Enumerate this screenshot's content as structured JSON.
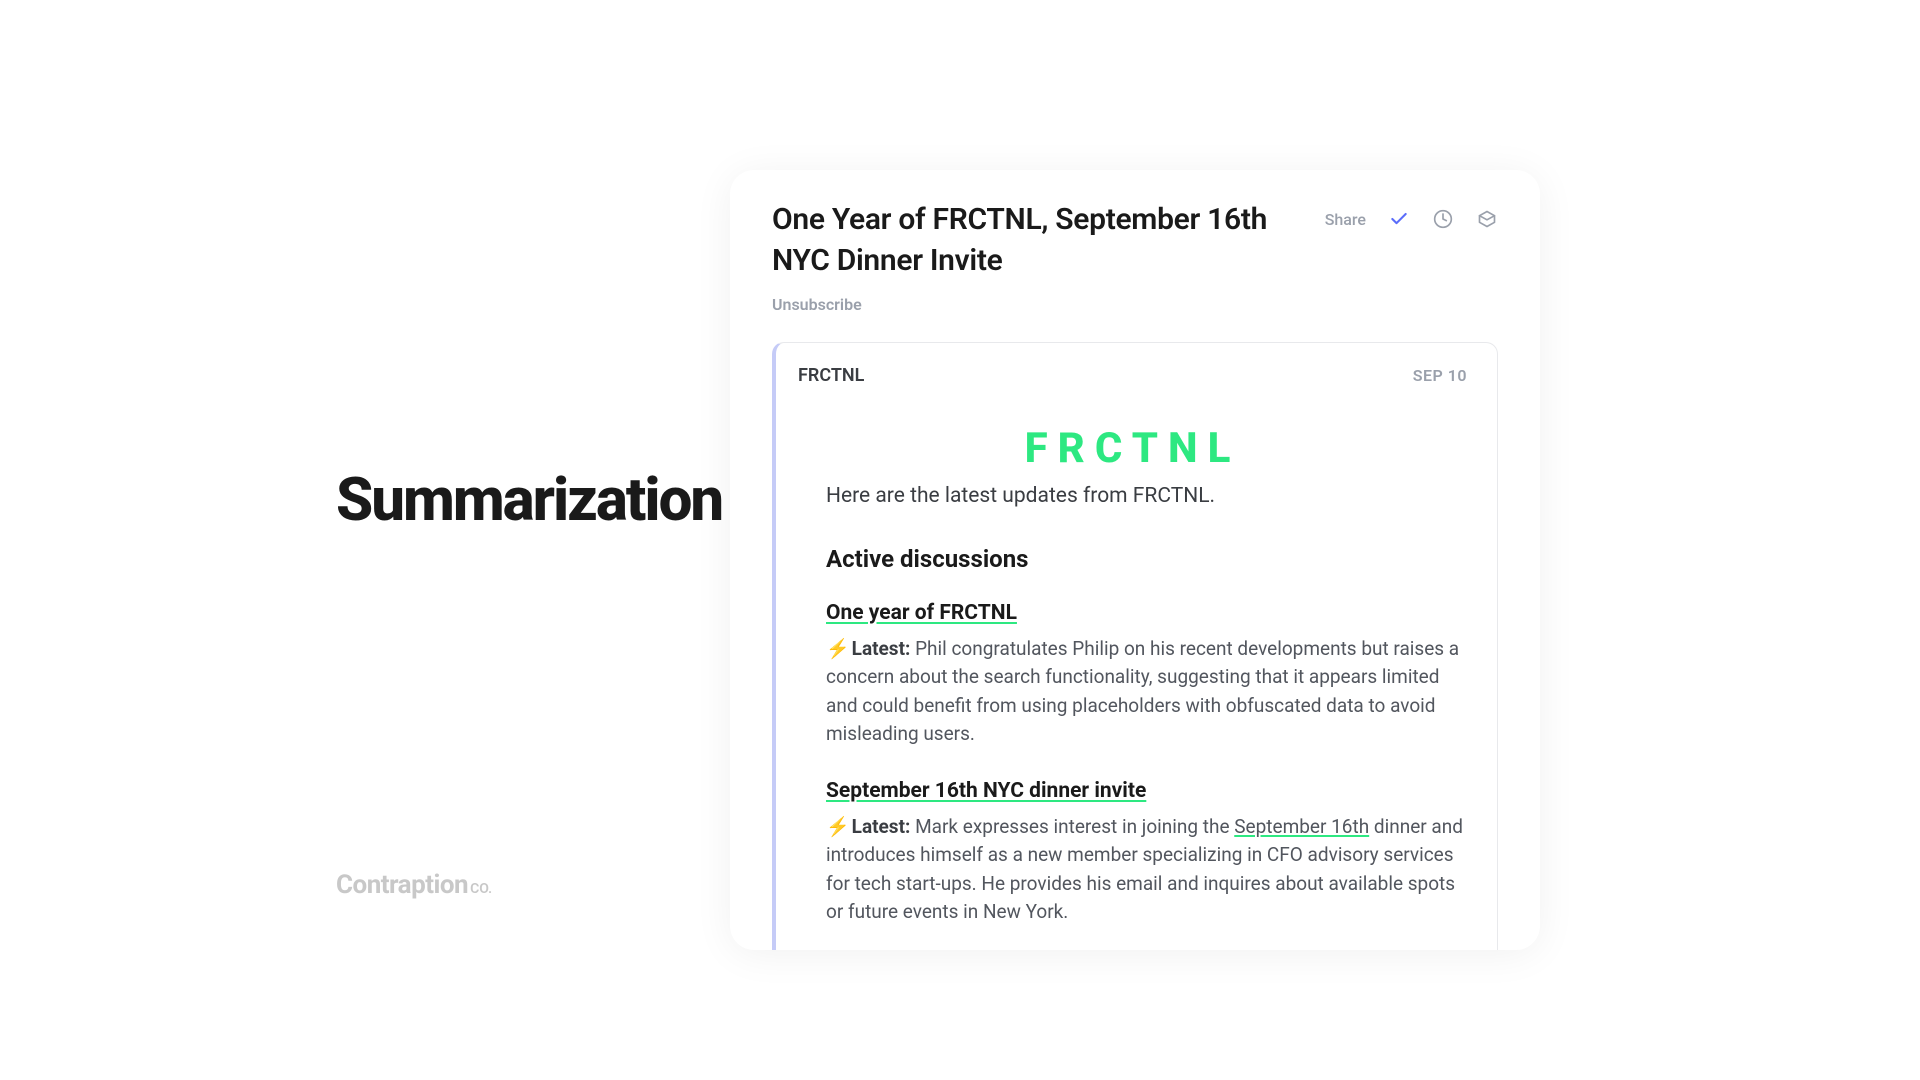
{
  "left": {
    "headline": "Summarization",
    "brand_main": "Contraption",
    "brand_suffix": "co."
  },
  "header": {
    "subject": "One Year of FRCTNL, September 16th NYC Dinner Invite",
    "share_label": "Share",
    "unsubscribe_label": "Unsubscribe"
  },
  "message": {
    "sender": "FRCTNL",
    "date": "SEP 10",
    "logo_text": "FRCTNL",
    "intro": "Here are the latest updates from FRCTNL.",
    "section_title": "Active discussions",
    "discussions": [
      {
        "title": "One year of FRCTNL",
        "bolt": "⚡",
        "latest_label": "Latest:",
        "body": " Phil congratulates Philip on his recent developments but raises a concern about the search functionality, suggesting that it appears limited and could benefit from using placeholders with obfuscated data to avoid misleading users."
      },
      {
        "title": "September 16th NYC dinner invite",
        "bolt": "⚡",
        "latest_label": "Latest:",
        "body_pre": " Mark expresses interest in joining the ",
        "body_link": "September 16th",
        "body_post": " dinner and introduces himself as a new member specializing in CFO advisory services for tech start-ups. He provides his email and inquires about available spots or future events in New York."
      }
    ]
  }
}
